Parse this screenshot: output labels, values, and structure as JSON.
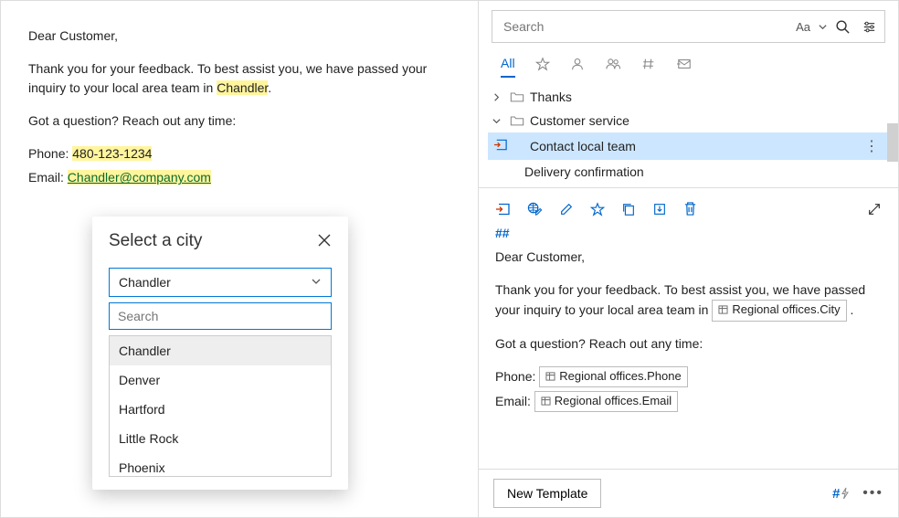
{
  "email": {
    "greeting": "Dear Customer,",
    "thanks_pre": "Thank you for your feedback. To best assist you, we have passed your inquiry to your local area team in ",
    "city_hl": "Chandler",
    "thanks_post": ".",
    "question": "Got a question? Reach out any time:",
    "phone_label": "Phone: ",
    "phone_value": "480-123-1234",
    "email_label": "Email: ",
    "email_value": "Chandler@company.com"
  },
  "popup": {
    "title": "Select a city",
    "selected": "Chandler",
    "search_placeholder": "Search",
    "options": [
      "Chandler",
      "Denver",
      "Hartford",
      "Little Rock",
      "Phoenix"
    ]
  },
  "search": {
    "placeholder": "Search",
    "aa": "Aa"
  },
  "tabs": {
    "all": "All"
  },
  "tree": {
    "thanks": "Thanks",
    "cs": "Customer service",
    "contact": "Contact local team",
    "delivery": "Delivery confirmation"
  },
  "preview": {
    "hash": "##",
    "greeting": "Dear Customer,",
    "p1_pre": "Thank you for your feedback. To best assist you, we have passed your inquiry to your local area team in ",
    "token_city": "Regional offices.City",
    "p1_post": " .",
    "question": "Got a question? Reach out any time:",
    "phone_label": "Phone: ",
    "token_phone": "Regional offices.Phone",
    "email_label": "Email: ",
    "token_email": "Regional offices.Email"
  },
  "footer": {
    "new_template": "New Template",
    "hash": "#"
  }
}
